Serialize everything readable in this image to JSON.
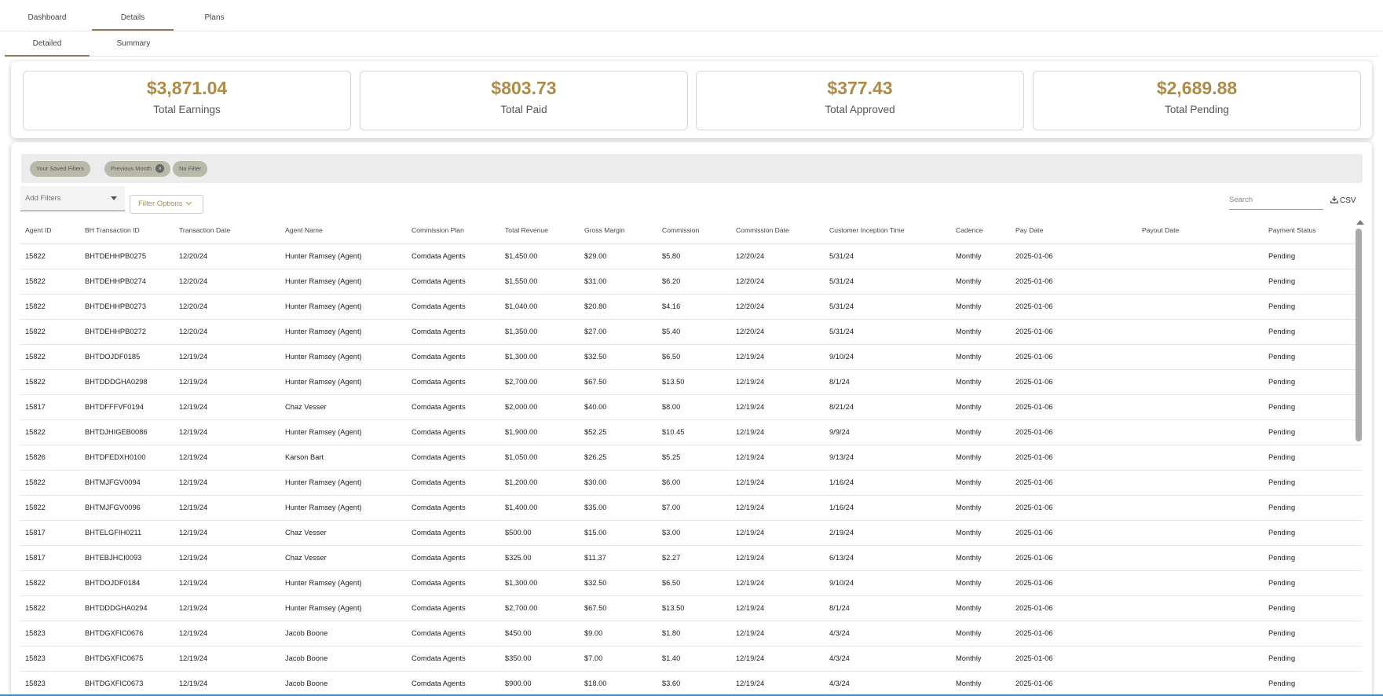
{
  "tabs": [
    {
      "label": "Dashboard"
    },
    {
      "label": "Details"
    },
    {
      "label": "Plans"
    }
  ],
  "subtabs": [
    {
      "label": "Detailed"
    },
    {
      "label": "Summary"
    }
  ],
  "stats": [
    {
      "value": "$3,871.04",
      "label": "Total Earnings"
    },
    {
      "value": "$803.73",
      "label": "Total Paid"
    },
    {
      "value": "$377.43",
      "label": "Total Approved"
    },
    {
      "value": "$2,689.88",
      "label": "Total Pending"
    }
  ],
  "filters": {
    "chips": [
      {
        "label": "Your Saved Filters"
      },
      {
        "label": "Previous Month"
      },
      {
        "label": "No Filter"
      }
    ],
    "add_filters_placeholder": "Add Filters",
    "filter_options_label": "Filter Options",
    "search_placeholder": "Search",
    "csv_label": "CSV"
  },
  "table": {
    "columns": [
      "Agent ID",
      "BH Transaction ID",
      "Transaction Date",
      "Agent Name",
      "Commission Plan",
      "Total Revenue",
      "Gross Margin",
      "Commission",
      "Commission Date",
      "Customer Inception Time",
      "Cadence",
      "Pay Date",
      "Payout Date",
      "Payment Status"
    ],
    "rows": [
      [
        "15822",
        "BHTDEHHPB0275",
        "12/20/24",
        "Hunter Ramsey (Agent)",
        "Comdata Agents",
        "$1,450.00",
        "$29.00",
        "$5.80",
        "12/20/24",
        "5/31/24",
        "Monthly",
        "2025-01-06",
        "",
        "Pending"
      ],
      [
        "15822",
        "BHTDEHHPB0274",
        "12/20/24",
        "Hunter Ramsey (Agent)",
        "Comdata Agents",
        "$1,550.00",
        "$31.00",
        "$6.20",
        "12/20/24",
        "5/31/24",
        "Monthly",
        "2025-01-06",
        "",
        "Pending"
      ],
      [
        "15822",
        "BHTDEHHPB0273",
        "12/20/24",
        "Hunter Ramsey (Agent)",
        "Comdata Agents",
        "$1,040.00",
        "$20.80",
        "$4.16",
        "12/20/24",
        "5/31/24",
        "Monthly",
        "2025-01-06",
        "",
        "Pending"
      ],
      [
        "15822",
        "BHTDEHHPB0272",
        "12/20/24",
        "Hunter Ramsey (Agent)",
        "Comdata Agents",
        "$1,350.00",
        "$27.00",
        "$5.40",
        "12/20/24",
        "5/31/24",
        "Monthly",
        "2025-01-06",
        "",
        "Pending"
      ],
      [
        "15822",
        "BHTDOJDF0185",
        "12/19/24",
        "Hunter Ramsey (Agent)",
        "Comdata Agents",
        "$1,300.00",
        "$32.50",
        "$6.50",
        "12/19/24",
        "9/10/24",
        "Monthly",
        "2025-01-06",
        "",
        "Pending"
      ],
      [
        "15822",
        "BHTDDDGHA0298",
        "12/19/24",
        "Hunter Ramsey (Agent)",
        "Comdata Agents",
        "$2,700.00",
        "$67.50",
        "$13.50",
        "12/19/24",
        "8/1/24",
        "Monthly",
        "2025-01-06",
        "",
        "Pending"
      ],
      [
        "15817",
        "BHTDFFFVF0194",
        "12/19/24",
        "Chaz Vesser",
        "Comdata Agents",
        "$2,000.00",
        "$40.00",
        "$8.00",
        "12/19/24",
        "8/21/24",
        "Monthly",
        "2025-01-06",
        "",
        "Pending"
      ],
      [
        "15822",
        "BHTDJHIGEB0086",
        "12/19/24",
        "Hunter Ramsey (Agent)",
        "Comdata Agents",
        "$1,900.00",
        "$52.25",
        "$10.45",
        "12/19/24",
        "9/9/24",
        "Monthly",
        "2025-01-06",
        "",
        "Pending"
      ],
      [
        "15826",
        "BHTDFEDXH0100",
        "12/19/24",
        "Karson Bart",
        "Comdata Agents",
        "$1,050.00",
        "$26.25",
        "$5.25",
        "12/19/24",
        "9/13/24",
        "Monthly",
        "2025-01-06",
        "",
        "Pending"
      ],
      [
        "15822",
        "BHTMJFGV0094",
        "12/19/24",
        "Hunter Ramsey (Agent)",
        "Comdata Agents",
        "$1,200.00",
        "$30.00",
        "$6.00",
        "12/19/24",
        "1/16/24",
        "Monthly",
        "2025-01-06",
        "",
        "Pending"
      ],
      [
        "15822",
        "BHTMJFGV0096",
        "12/19/24",
        "Hunter Ramsey (Agent)",
        "Comdata Agents",
        "$1,400.00",
        "$35.00",
        "$7.00",
        "12/19/24",
        "1/16/24",
        "Monthly",
        "2025-01-06",
        "",
        "Pending"
      ],
      [
        "15817",
        "BHTELGFIH0211",
        "12/19/24",
        "Chaz Vesser",
        "Comdata Agents",
        "$500.00",
        "$15.00",
        "$3.00",
        "12/19/24",
        "2/19/24",
        "Monthly",
        "2025-01-06",
        "",
        "Pending"
      ],
      [
        "15817",
        "BHTEBJHCI0093",
        "12/19/24",
        "Chaz Vesser",
        "Comdata Agents",
        "$325.00",
        "$11.37",
        "$2.27",
        "12/19/24",
        "6/13/24",
        "Monthly",
        "2025-01-06",
        "",
        "Pending"
      ],
      [
        "15822",
        "BHTDOJDF0184",
        "12/19/24",
        "Hunter Ramsey (Agent)",
        "Comdata Agents",
        "$1,300.00",
        "$32.50",
        "$6.50",
        "12/19/24",
        "9/10/24",
        "Monthly",
        "2025-01-06",
        "",
        "Pending"
      ],
      [
        "15822",
        "BHTDDDGHA0294",
        "12/19/24",
        "Hunter Ramsey (Agent)",
        "Comdata Agents",
        "$2,700.00",
        "$67.50",
        "$13.50",
        "12/19/24",
        "8/1/24",
        "Monthly",
        "2025-01-06",
        "",
        "Pending"
      ],
      [
        "15823",
        "BHTDGXFIC0676",
        "12/19/24",
        "Jacob Boone",
        "Comdata Agents",
        "$450.00",
        "$9.00",
        "$1.80",
        "12/19/24",
        "4/3/24",
        "Monthly",
        "2025-01-06",
        "",
        "Pending"
      ],
      [
        "15823",
        "BHTDGXFIC0675",
        "12/19/24",
        "Jacob Boone",
        "Comdata Agents",
        "$350.00",
        "$7.00",
        "$1.40",
        "12/19/24",
        "4/3/24",
        "Monthly",
        "2025-01-06",
        "",
        "Pending"
      ],
      [
        "15823",
        "BHTDGXFIC0673",
        "12/19/24",
        "Jacob Boone",
        "Comdata Agents",
        "$900.00",
        "$18.00",
        "$3.60",
        "12/19/24",
        "4/3/24",
        "Monthly",
        "2025-01-06",
        "",
        "Pending"
      ]
    ]
  }
}
